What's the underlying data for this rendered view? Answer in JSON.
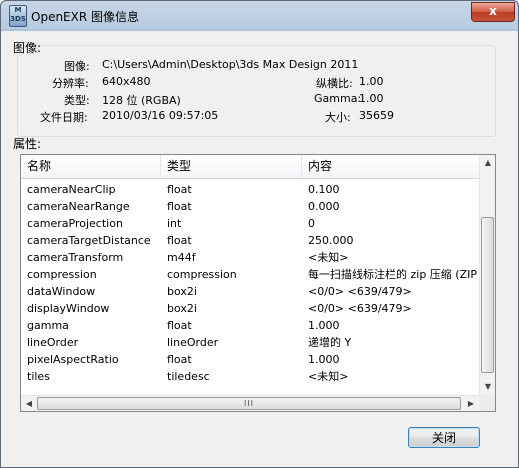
{
  "window": {
    "title": "OpenEXR 图像信息",
    "app_icon_text": "M\n3DS",
    "close_glyph": "x"
  },
  "image_group": {
    "title": "图像:",
    "path_label": "图像:",
    "path_value": "C:\\Users\\Admin\\Desktop\\3ds Max Design 2011",
    "resolution_label": "分辨率:",
    "resolution_value": "640x480",
    "type_label": "类型:",
    "type_value": "128 位 (RGBA)",
    "date_label": "文件日期:",
    "date_value": "2010/03/16 09:57:05",
    "aspect_label": "纵横比:",
    "aspect_value": "1.00",
    "gamma_label": "Gamma:",
    "gamma_value": "1.00",
    "size_label": "大小:",
    "size_value": "35659"
  },
  "properties": {
    "title": "属性:",
    "columns": [
      "名称",
      "类型",
      "内容"
    ],
    "rows": [
      [
        "cameraNearClip",
        "float",
        "0.100"
      ],
      [
        "cameraNearRange",
        "float",
        "0.000"
      ],
      [
        "cameraProjection",
        "int",
        "0"
      ],
      [
        "cameraTargetDistance",
        "float",
        "250.000"
      ],
      [
        "cameraTransform",
        "m44f",
        "<未知>"
      ],
      [
        "compression",
        "compression",
        "每一扫描线标注栏的 zip 压缩 (ZIP"
      ],
      [
        "dataWindow",
        "box2i",
        "<0/0> <639/479>"
      ],
      [
        "displayWindow",
        "box2i",
        "<0/0> <639/479>"
      ],
      [
        "gamma",
        "float",
        "1.000"
      ],
      [
        "lineOrder",
        "lineOrder",
        "递增的 Y"
      ],
      [
        "pixelAspectRatio",
        "float",
        "1.000"
      ],
      [
        "tiles",
        "tiledesc",
        "<未知>"
      ]
    ]
  },
  "scrollbars": {
    "up_arrow": "▲",
    "down_arrow": "▼",
    "left_arrow": "◀",
    "right_arrow": "▶",
    "thumb_grip": "III"
  },
  "footer": {
    "close_label": "关闭"
  }
}
